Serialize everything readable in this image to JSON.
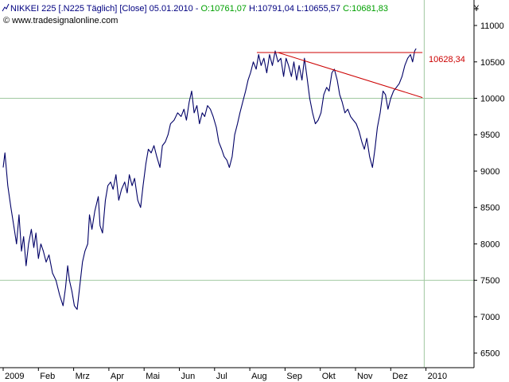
{
  "header": {
    "icon": "line-chart-icon",
    "line_start": "NIKKEI 225 [.N225 Täglich] [Close] 05.01.2010 - ",
    "open": "O:10761,07",
    "high": " H:10791,04",
    "low": " L:10655,57",
    "close": " C:10681,83",
    "copyright": "© www.tradesignalonline.com",
    "colors": {
      "text": "#000080",
      "ohlc_green": "#00a000"
    }
  },
  "chart_data": {
    "type": "line",
    "currency_label": "¥",
    "ylim": [
      6300,
      11350
    ],
    "y_ticks": [
      6500,
      7000,
      7500,
      8000,
      8500,
      9000,
      9500,
      10000,
      10500,
      11000
    ],
    "y_tick_labels": [
      "6500",
      "7000",
      "7500",
      "8000",
      "8500",
      "9000",
      "9500",
      "10000",
      "10500",
      "11000"
    ],
    "gridlines_y": [
      7500,
      10000
    ],
    "x_ticks": [
      {
        "label": "2009",
        "t": 0
      },
      {
        "label": "Feb",
        "t": 1
      },
      {
        "label": "Mrz",
        "t": 2
      },
      {
        "label": "Apr",
        "t": 3
      },
      {
        "label": "Mai",
        "t": 4
      },
      {
        "label": "Jun",
        "t": 5
      },
      {
        "label": "Jul",
        "t": 6
      },
      {
        "label": "Aug",
        "t": 7
      },
      {
        "label": "Sep",
        "t": 8
      },
      {
        "label": "Okt",
        "t": 9
      },
      {
        "label": "Nov",
        "t": 10
      },
      {
        "label": "Dez",
        "t": 11
      },
      {
        "label": "2010",
        "t": 12
      }
    ],
    "series": [
      {
        "color": "#000066",
        "points": [
          [
            0.0,
            9050
          ],
          [
            0.05,
            9250
          ],
          [
            0.13,
            8800
          ],
          [
            0.22,
            8500
          ],
          [
            0.3,
            8250
          ],
          [
            0.38,
            8000
          ],
          [
            0.45,
            8400
          ],
          [
            0.52,
            7900
          ],
          [
            0.58,
            8100
          ],
          [
            0.65,
            7700
          ],
          [
            0.72,
            8000
          ],
          [
            0.8,
            8200
          ],
          [
            0.87,
            7950
          ],
          [
            0.93,
            8150
          ],
          [
            1.0,
            7800
          ],
          [
            1.07,
            8000
          ],
          [
            1.14,
            7900
          ],
          [
            1.22,
            7750
          ],
          [
            1.3,
            7850
          ],
          [
            1.4,
            7600
          ],
          [
            1.5,
            7500
          ],
          [
            1.6,
            7300
          ],
          [
            1.7,
            7150
          ],
          [
            1.77,
            7400
          ],
          [
            1.83,
            7700
          ],
          [
            1.88,
            7500
          ],
          [
            1.95,
            7350
          ],
          [
            2.02,
            7150
          ],
          [
            2.1,
            7100
          ],
          [
            2.18,
            7450
          ],
          [
            2.25,
            7750
          ],
          [
            2.32,
            7900
          ],
          [
            2.4,
            8000
          ],
          [
            2.45,
            8400
          ],
          [
            2.52,
            8200
          ],
          [
            2.6,
            8450
          ],
          [
            2.7,
            8650
          ],
          [
            2.75,
            8250
          ],
          [
            2.82,
            8150
          ],
          [
            2.9,
            8600
          ],
          [
            2.97,
            8800
          ],
          [
            3.05,
            8850
          ],
          [
            3.12,
            8750
          ],
          [
            3.2,
            8950
          ],
          [
            3.28,
            8600
          ],
          [
            3.36,
            8750
          ],
          [
            3.45,
            8850
          ],
          [
            3.52,
            8700
          ],
          [
            3.58,
            8950
          ],
          [
            3.66,
            8800
          ],
          [
            3.73,
            8900
          ],
          [
            3.82,
            8600
          ],
          [
            3.9,
            8500
          ],
          [
            3.97,
            8800
          ],
          [
            4.05,
            9100
          ],
          [
            4.12,
            9300
          ],
          [
            4.2,
            9250
          ],
          [
            4.28,
            9350
          ],
          [
            4.36,
            9200
          ],
          [
            4.45,
            9050
          ],
          [
            4.52,
            9350
          ],
          [
            4.6,
            9400
          ],
          [
            4.68,
            9500
          ],
          [
            4.75,
            9650
          ],
          [
            4.85,
            9700
          ],
          [
            4.95,
            9800
          ],
          [
            5.05,
            9750
          ],
          [
            5.13,
            9850
          ],
          [
            5.2,
            9700
          ],
          [
            5.28,
            9950
          ],
          [
            5.35,
            10100
          ],
          [
            5.42,
            9800
          ],
          [
            5.5,
            9900
          ],
          [
            5.57,
            9650
          ],
          [
            5.65,
            9800
          ],
          [
            5.72,
            9750
          ],
          [
            5.8,
            9900
          ],
          [
            5.88,
            9850
          ],
          [
            5.96,
            9750
          ],
          [
            6.05,
            9600
          ],
          [
            6.12,
            9400
          ],
          [
            6.2,
            9300
          ],
          [
            6.27,
            9200
          ],
          [
            6.35,
            9150
          ],
          [
            6.42,
            9050
          ],
          [
            6.5,
            9200
          ],
          [
            6.57,
            9500
          ],
          [
            6.65,
            9650
          ],
          [
            6.72,
            9800
          ],
          [
            6.8,
            9950
          ],
          [
            6.88,
            10100
          ],
          [
            6.95,
            10250
          ],
          [
            7.02,
            10350
          ],
          [
            7.1,
            10500
          ],
          [
            7.18,
            10400
          ],
          [
            7.25,
            10600
          ],
          [
            7.32,
            10450
          ],
          [
            7.4,
            10550
          ],
          [
            7.48,
            10350
          ],
          [
            7.56,
            10600
          ],
          [
            7.64,
            10450
          ],
          [
            7.72,
            10650
          ],
          [
            7.8,
            10500
          ],
          [
            7.88,
            10550
          ],
          [
            7.96,
            10300
          ],
          [
            8.03,
            10550
          ],
          [
            8.1,
            10450
          ],
          [
            8.18,
            10300
          ],
          [
            8.25,
            10500
          ],
          [
            8.33,
            10250
          ],
          [
            8.4,
            10450
          ],
          [
            8.48,
            10250
          ],
          [
            8.55,
            10550
          ],
          [
            8.62,
            10300
          ],
          [
            8.7,
            10000
          ],
          [
            8.78,
            9800
          ],
          [
            8.86,
            9650
          ],
          [
            8.94,
            9700
          ],
          [
            9.02,
            9800
          ],
          [
            9.1,
            10050
          ],
          [
            9.18,
            10150
          ],
          [
            9.25,
            10100
          ],
          [
            9.33,
            10350
          ],
          [
            9.4,
            10400
          ],
          [
            9.48,
            10250
          ],
          [
            9.55,
            10050
          ],
          [
            9.62,
            9950
          ],
          [
            9.7,
            9800
          ],
          [
            9.78,
            9850
          ],
          [
            9.86,
            9750
          ],
          [
            9.94,
            9700
          ],
          [
            10.02,
            9650
          ],
          [
            10.1,
            9550
          ],
          [
            10.18,
            9400
          ],
          [
            10.25,
            9300
          ],
          [
            10.32,
            9450
          ],
          [
            10.4,
            9200
          ],
          [
            10.48,
            9050
          ],
          [
            10.55,
            9300
          ],
          [
            10.62,
            9600
          ],
          [
            10.7,
            9800
          ],
          [
            10.78,
            10100
          ],
          [
            10.85,
            10050
          ],
          [
            10.92,
            9850
          ],
          [
            11.0,
            10000
          ],
          [
            11.08,
            10100
          ],
          [
            11.16,
            10150
          ],
          [
            11.24,
            10200
          ],
          [
            11.32,
            10300
          ],
          [
            11.4,
            10450
          ],
          [
            11.48,
            10550
          ],
          [
            11.56,
            10600
          ],
          [
            11.62,
            10500
          ],
          [
            11.68,
            10650
          ],
          [
            11.72,
            10682
          ]
        ]
      }
    ],
    "annotations": [
      {
        "type": "horizontal-line",
        "color": "#cc0000",
        "y": 10628.34,
        "t_start": 7.2,
        "t_end": 11.9,
        "label": "10628,34"
      },
      {
        "type": "trend-line",
        "color": "#cc0000",
        "t1": 7.8,
        "y1": 10628.34,
        "t2": 11.9,
        "y2": 10010
      }
    ],
    "cursor_line_t": 11.95,
    "grid": true,
    "legend": "none",
    "colors": {
      "axis": "#000000",
      "grid": "#a0c8a0",
      "cursor": "#a0c8a0"
    }
  }
}
